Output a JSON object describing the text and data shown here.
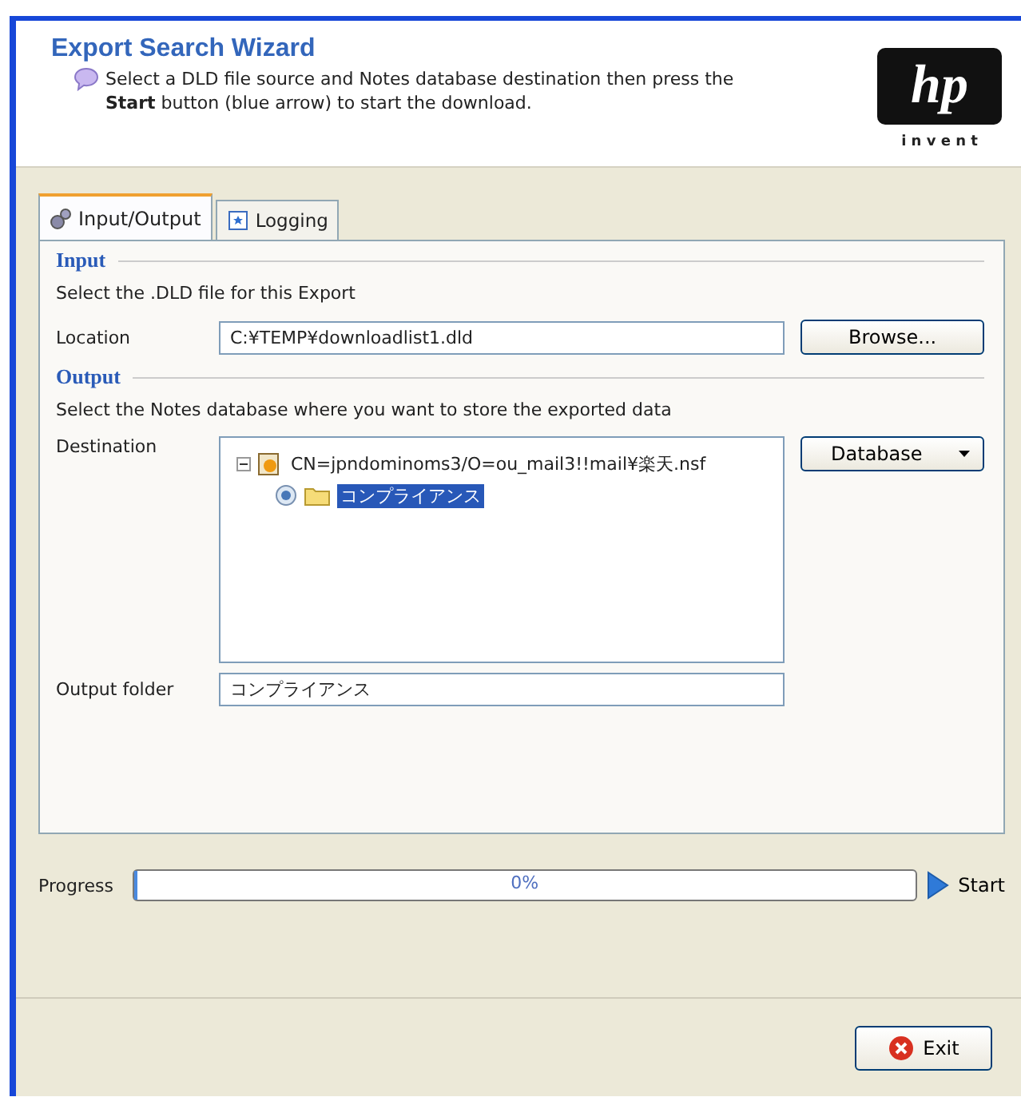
{
  "header": {
    "title": "Export Search Wizard",
    "intro": "Select a DLD file source and Notes database destination then press the **Start** button (blue arrow) to start the download.",
    "logo": {
      "mark": "hp",
      "tagline": "i n v e n t"
    }
  },
  "tabs": [
    {
      "label": "Input/Output",
      "selected": true
    },
    {
      "label": "Logging",
      "selected": false
    }
  ],
  "input": {
    "heading": "Input",
    "hint": "Select the .DLD file for this Export",
    "location_label": "Location",
    "location": "C:¥TEMP¥downloadlist1.dld",
    "browse": "Browse..."
  },
  "output": {
    "heading": "Output",
    "hint": "Select the Notes database where you want to store the exported data",
    "destination_label": "Destination",
    "database_button": "Database",
    "tree": [
      {
        "label": "CN=jpndominoms3/O=ou_mail3!!mail¥楽天.nsf",
        "expanded": true,
        "selected": false,
        "children": [
          {
            "label": "コンプライアンス",
            "selected": true
          }
        ]
      }
    ],
    "folder_label": "Output folder",
    "folder": "コンプライアンス"
  },
  "progress": {
    "label": "Progress",
    "level": 0,
    "reading": "0%",
    "start": "Start"
  },
  "exit": "Exit"
}
